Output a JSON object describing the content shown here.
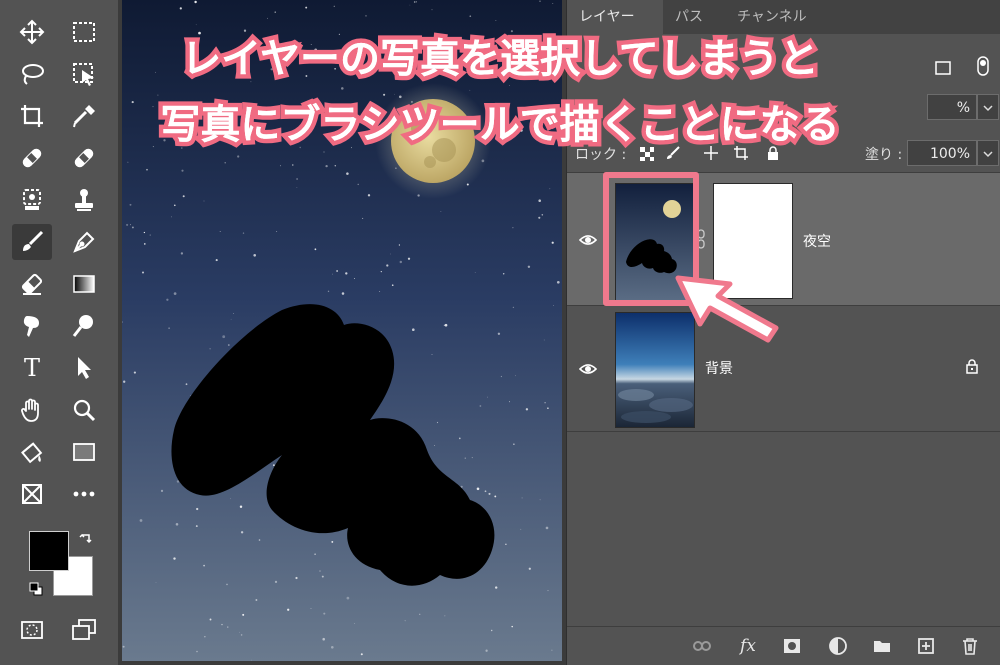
{
  "toolbar": {
    "tools": [
      {
        "name": "move-tool",
        "icon": "move-icon"
      },
      {
        "name": "marquee-tool",
        "icon": "rect-marquee-icon"
      },
      {
        "name": "lasso-tool",
        "icon": "lasso-icon"
      },
      {
        "name": "object-select-tool",
        "icon": "object-select-icon"
      },
      {
        "name": "crop-tool",
        "icon": "crop-icon"
      },
      {
        "name": "eyedropper-tool",
        "icon": "eyedropper-icon"
      },
      {
        "name": "healing-tool",
        "icon": "bandage-icon"
      },
      {
        "name": "patch-tool",
        "icon": "bandage-icon"
      },
      {
        "name": "clone-tool",
        "icon": "stamp-icon"
      },
      {
        "name": "history-brush-tool",
        "icon": "stamp-icon"
      },
      {
        "name": "brush-tool",
        "icon": "brush-icon",
        "active": true
      },
      {
        "name": "pen-tool",
        "icon": "pen-icon"
      },
      {
        "name": "eraser-tool",
        "icon": "eraser-icon"
      },
      {
        "name": "gradient-tool",
        "icon": "gradient-icon"
      },
      {
        "name": "smudge-tool",
        "icon": "smudge-icon"
      },
      {
        "name": "dodge-tool",
        "icon": "dodge-icon"
      },
      {
        "name": "type-tool",
        "icon": "type-icon",
        "glyph": "T"
      },
      {
        "name": "path-select-tool",
        "icon": "arrow-cursor-icon"
      },
      {
        "name": "hand-tool",
        "icon": "hand-icon"
      },
      {
        "name": "zoom-tool",
        "icon": "zoom-icon"
      },
      {
        "name": "paint-bucket-tool",
        "icon": "bucket-icon"
      },
      {
        "name": "rectangle-tool",
        "icon": "rectangle-icon"
      },
      {
        "name": "frame-tool",
        "icon": "frame-icon"
      },
      {
        "name": "more-tools",
        "icon": "ellipsis-icon"
      }
    ],
    "foreground_color": "#000000",
    "background_color": "#ffffff"
  },
  "panel": {
    "tabs": [
      {
        "label": "レイヤー",
        "active": true
      },
      {
        "label": "パス",
        "active": false
      },
      {
        "label": "チャンネル",
        "active": false
      }
    ],
    "opacity_value": "%",
    "lock_label": "ロック :",
    "fill_label": "塗り :",
    "fill_value": "100%",
    "layers": [
      {
        "name": "夜空",
        "selected": true,
        "visible": true,
        "has_mask": true,
        "locked": false
      },
      {
        "name": "背景",
        "selected": false,
        "visible": true,
        "has_mask": false,
        "locked": true
      }
    ],
    "bottom_icons": [
      "link-icon",
      "fx-icon",
      "mask-icon",
      "adjustment-icon",
      "folder-icon",
      "new-layer-icon",
      "trash-icon"
    ],
    "fx_label": "fx"
  },
  "overlay": {
    "line1": "レイヤーの写真を選択してしまうと",
    "line2": "写真にブラシツールで描くことになる",
    "stroke_color": "#f06b82",
    "text_color": "#ffffff"
  },
  "colors": {
    "panel_bg": "#535353",
    "highlight": "#f0798d",
    "selected_layer": "#6a6a6a"
  }
}
